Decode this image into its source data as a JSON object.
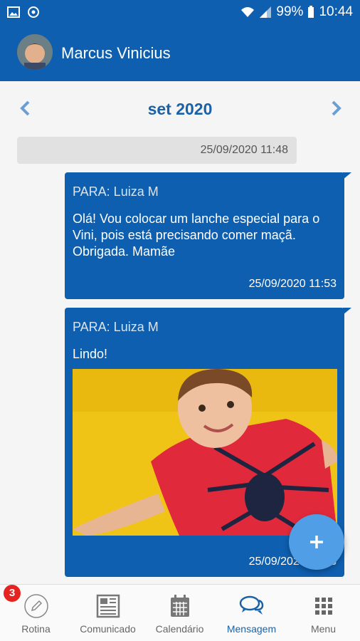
{
  "statusbar": {
    "battery": "99%",
    "time": "10:44"
  },
  "header": {
    "user_name": "Marcus Vinicius"
  },
  "month_nav": {
    "label": "set 2020"
  },
  "date_separator": "25/09/2020 11:48",
  "messages": [
    {
      "to": "PARA: Luiza M",
      "text": "Olá! Vou colocar um lanche especial para o Vini, pois está precisando comer maçã. Obrigada. Mamãe",
      "time": "25/09/2020 11:53"
    },
    {
      "to": "PARA: Luiza M",
      "text": "Lindo!",
      "time": "25/09/2020 11:53"
    }
  ],
  "bottom_nav": {
    "badge_count": "3",
    "tabs": [
      {
        "label": "Rotina",
        "icon": "pencil-circle-icon"
      },
      {
        "label": "Comunicado",
        "icon": "newspaper-icon"
      },
      {
        "label": "Calendário",
        "icon": "calendar-icon"
      },
      {
        "label": "Mensagem",
        "icon": "chat-bubbles-icon"
      },
      {
        "label": "Menu",
        "icon": "grid-icon"
      }
    ]
  },
  "colors": {
    "primary": "#0e5fb0",
    "accent": "#1a62a8",
    "fab": "#4f9ee6",
    "badge": "#e52320"
  }
}
